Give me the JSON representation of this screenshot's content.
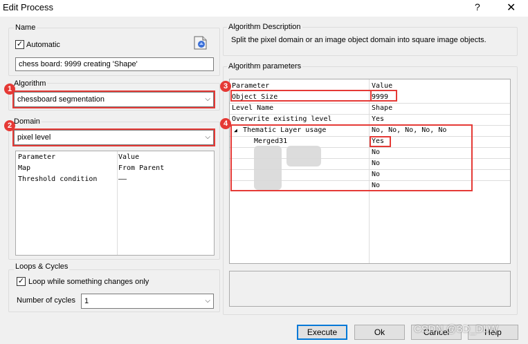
{
  "window": {
    "title": "Edit Process",
    "help": "?",
    "close": "✕"
  },
  "name_group": {
    "label": "Name",
    "automatic_label": "Automatic",
    "automatic_checked": "✓",
    "name_value": "chess board: 9999 creating 'Shape'"
  },
  "algorithm_group": {
    "label": "Algorithm",
    "value": "chessboard segmentation"
  },
  "domain_group": {
    "label": "Domain",
    "value": "pixel level",
    "headers": [
      "Parameter",
      "Value"
    ],
    "rows": [
      [
        "Map",
        "From Parent"
      ],
      [
        "Threshold condition",
        "——"
      ]
    ]
  },
  "loops_group": {
    "label": "Loops & Cycles",
    "loop_label": "Loop while something changes only",
    "loop_checked": "✓",
    "cycles_label": "Number of cycles",
    "cycles_value": "1"
  },
  "description_group": {
    "label": "Algorithm Description",
    "text": "Split the pixel domain or an image object domain into square image objects."
  },
  "params_group": {
    "label": "Algorithm parameters",
    "headers": [
      "Parameter",
      "Value"
    ],
    "rows": [
      {
        "name": "Object Size",
        "value": "9999"
      },
      {
        "name": "Level Name",
        "value": "Shape"
      },
      {
        "name": "Overwrite existing level",
        "value": "Yes"
      },
      {
        "name": "Thematic Layer usage",
        "value": "No, No, No, No, No"
      },
      {
        "name": "Merged31",
        "value": "Yes"
      },
      {
        "name": "",
        "value": "No"
      },
      {
        "name": "",
        "value": "No"
      },
      {
        "name": "",
        "value": "No"
      },
      {
        "name": "",
        "value": "No"
      }
    ],
    "expander": "◢"
  },
  "buttons": {
    "execute": "Execute",
    "ok": "Ok",
    "cancel": "Cancel",
    "help": "Help"
  },
  "badges": [
    "1",
    "2",
    "3",
    "4"
  ],
  "watermark": "CSDN @3D_DLW",
  "colors": {
    "highlight": "#e53935",
    "primary_border": "#0078d7"
  }
}
